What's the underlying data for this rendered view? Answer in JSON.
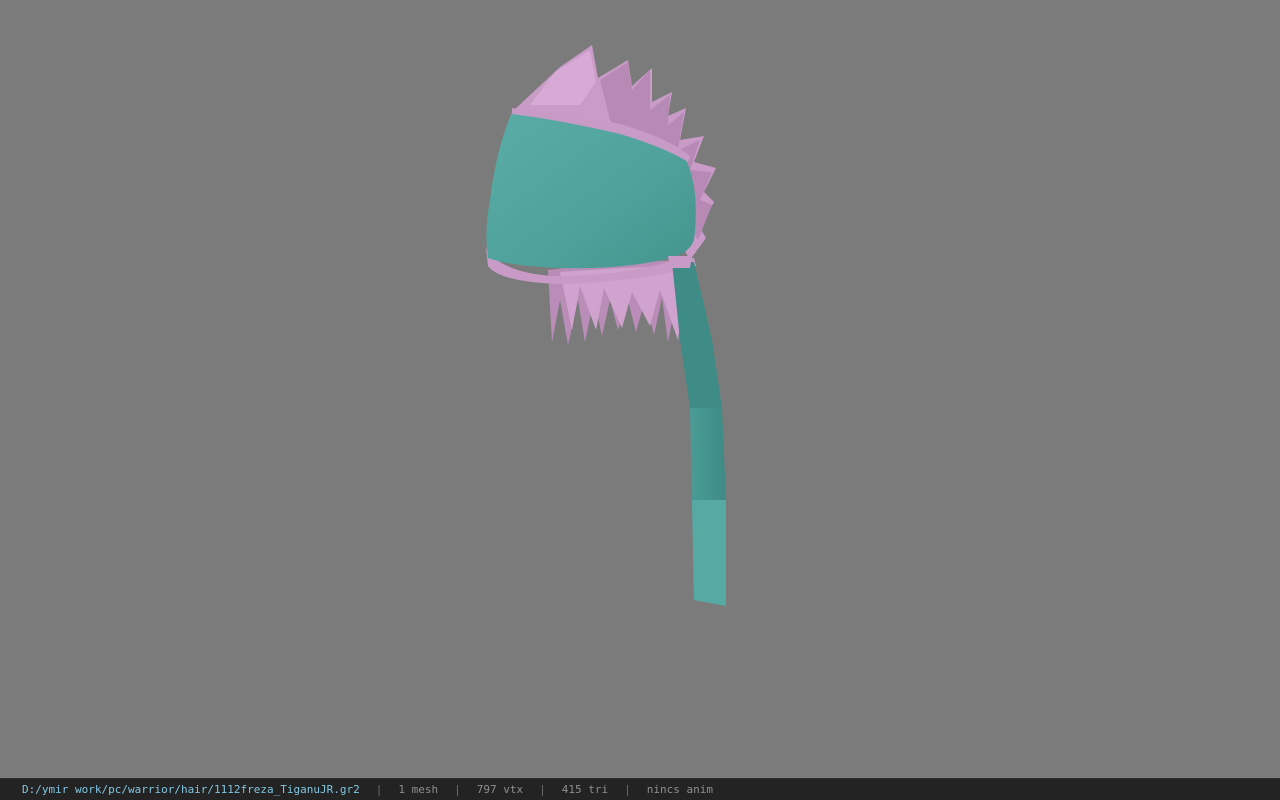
{
  "viewport": {
    "background": "#7b7b7b",
    "model": {
      "name": "hair-mesh",
      "colors": {
        "cloth": "#4fa19b",
        "cloth_dark": "#3f8883",
        "hair": "#c79ac6",
        "hair_dark": "#a57aa4"
      }
    }
  },
  "status_bar": {
    "path": "D:/ymir work/pc/warrior/hair/1112freza_TiganuJR.gr2",
    "sep1": "|",
    "mesh": "1 mesh",
    "sep2": "|",
    "vtx": "797 vtx",
    "sep3": "|",
    "tri": "415 tri",
    "sep4": "|",
    "anim": "nincs anim"
  }
}
